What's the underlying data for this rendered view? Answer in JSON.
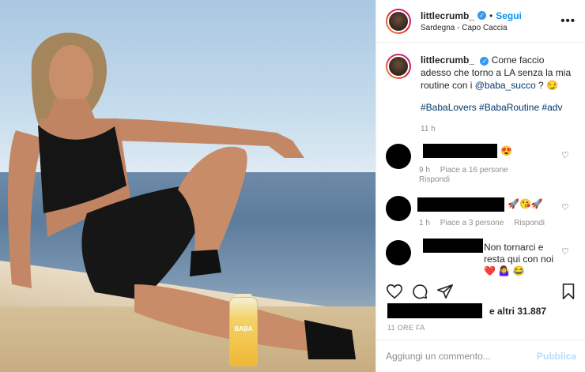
{
  "post": {
    "username": "littlecrumb_",
    "verified_mark": "✓",
    "separator": "•",
    "follow_label": "Segui",
    "location": "Sardegna - Capo Caccia",
    "more_label": "•••",
    "bottle_label": "BABA"
  },
  "caption": {
    "username": "littlecrumb_",
    "text_before": "Come faccio adesso che torno a LA senza la mia routine con i ",
    "mention": "@baba_succo",
    "text_after": " ? 😏",
    "hashtags": "#BabaLovers #BabaRoutine #adv",
    "time": "11 h"
  },
  "comments": [
    {
      "text": "😍",
      "meta": [
        "9 h",
        "Piace a 16 persone",
        "Rispondi"
      ]
    },
    {
      "text": "🚀😘🚀",
      "meta": [
        "1 h",
        "Piace a 3 persone",
        "Rispondi"
      ]
    },
    {
      "text": "Non tornarci e resta qui con noi❤️ 🤷‍♀️ 😂",
      "meta": []
    }
  ],
  "actions": {
    "likes_text": "e altri 31.887",
    "post_time": "11 ORE FA"
  },
  "composer": {
    "placeholder": "Aggiungi un commento...",
    "publish_label": "Pubblica"
  },
  "colors": {
    "accent_blue": "#0095f6",
    "link_blue": "#00376b",
    "muted": "#8e8e8e",
    "publish_disabled": "#b2dffc"
  },
  "icons": [
    "more-options-icon",
    "verified-icon",
    "heart-icon",
    "comment-icon",
    "share-icon",
    "bookmark-icon"
  ]
}
